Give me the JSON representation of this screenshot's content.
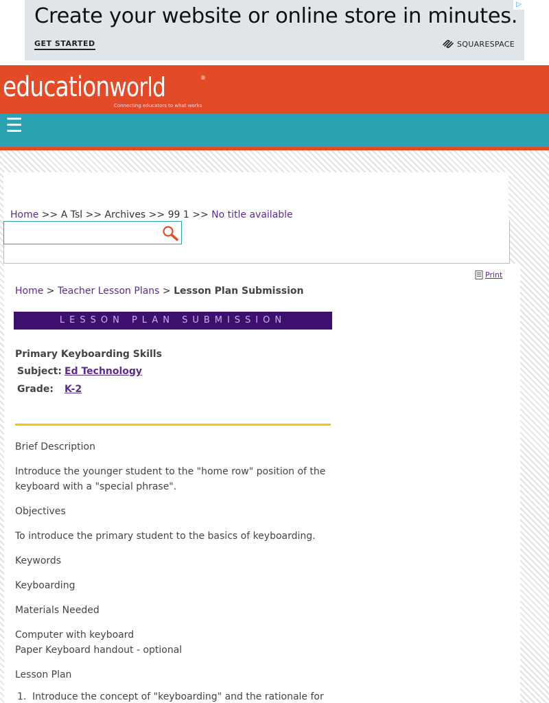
{
  "ad": {
    "headline": "Create your website or online store in minutes.",
    "cta": "GET STARTED",
    "brand": "SQUARESPACE",
    "adchoices_icon": "adchoices-icon"
  },
  "header": {
    "logo_text_1": "education",
    "logo_text_2": "world",
    "logo_reg": "®",
    "tagline": "Connecting educators to what works",
    "menu_icon": "☰",
    "brand_color": "#e34a27",
    "nav_color": "#2aa2b2"
  },
  "breadcrumb_top": {
    "home": "Home",
    "sep1": " >> ",
    "a": "A Tsl",
    "sep2": " >> ",
    "b": "Archives",
    "sep3": " >> ",
    "c": "99 1",
    "sep4": " >> ",
    "d": "No title available"
  },
  "search": {
    "value": "",
    "placeholder": ""
  },
  "print": {
    "label": "Print"
  },
  "breadcrumb": {
    "home": "Home",
    "sep1": " > ",
    "plans": "Teacher Lesson Plans",
    "sep2": " > ",
    "current": "Lesson Plan Submission"
  },
  "banner": {
    "text": "LESSON PLAN SUBMISSION",
    "bg": "#3d0f6e"
  },
  "lesson": {
    "title": "Primary Keyboarding Skills",
    "subject_label": "Subject:",
    "subject_value": "Ed Technology",
    "grade_label": "Grade:",
    "grade_value": "K-2"
  },
  "sections": {
    "brief_heading": "Brief Description",
    "brief_text": "Introduce the younger student to the \"home row\" position of the keyboard with a \"special phrase\".",
    "objectives_heading": "Objectives",
    "objectives_text": "To introduce the primary student to the basics of keyboarding.",
    "keywords_heading": "Keywords",
    "keywords_text": "Keyboarding",
    "materials_heading": "Materials Needed",
    "materials_line1": "Computer with keyboard",
    "materials_line2": "Paper Keyboard handout - optional",
    "plan_heading": "Lesson Plan",
    "plan_items": [
      {
        "num": "1.",
        "text": "Introduce the concept of \"keyboarding\" and the rationale for"
      }
    ]
  }
}
